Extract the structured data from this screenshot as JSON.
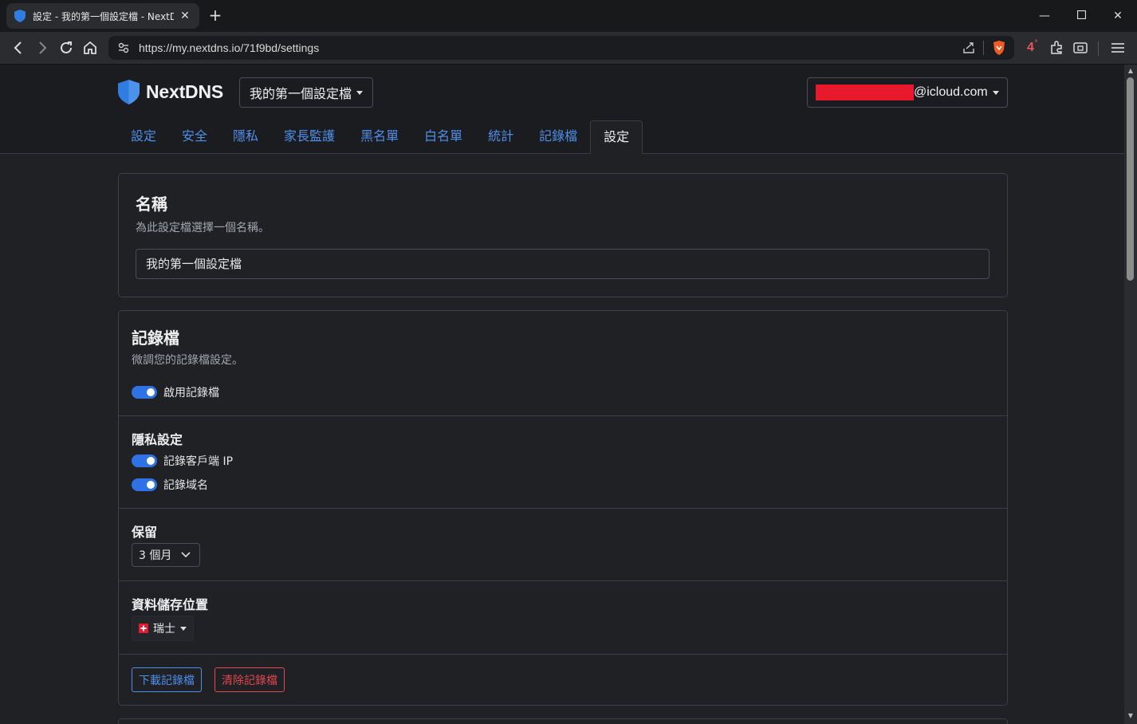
{
  "browser": {
    "tab_title": "設定 - 我的第一個設定檔 - NextDNS",
    "url": "https://my.nextdns.io/71f9bd/settings",
    "badge_count": "4"
  },
  "header": {
    "logo_text": "NextDNS",
    "profile_name": "我的第一個設定檔",
    "account_suffix": "@icloud.com"
  },
  "nav": {
    "tabs": [
      {
        "label": "設定"
      },
      {
        "label": "安全"
      },
      {
        "label": "隱私"
      },
      {
        "label": "家長監護"
      },
      {
        "label": "黑名單"
      },
      {
        "label": "白名單"
      },
      {
        "label": "統計"
      },
      {
        "label": "記錄檔"
      },
      {
        "label": "設定"
      }
    ]
  },
  "name_card": {
    "title": "名稱",
    "subtitle": "為此設定檔選擇一個名稱。",
    "value": "我的第一個設定檔"
  },
  "logs_card": {
    "title": "記錄檔",
    "subtitle": "微調您的記錄檔設定。",
    "enable_label": "啟用記錄檔",
    "privacy_title": "隱私設定",
    "log_client_ip_label": "記錄客戶端 IP",
    "log_domains_label": "記錄域名",
    "retention_title": "保留",
    "retention_value": "3 個月",
    "storage_title": "資料儲存位置",
    "storage_value": "瑞士",
    "download_button": "下載記錄檔",
    "clear_button": "清除記錄檔"
  },
  "colors": {
    "accent": "#2f72e6",
    "link": "#4f8fea",
    "danger": "#e0484f",
    "redaction": "#e8192c"
  }
}
